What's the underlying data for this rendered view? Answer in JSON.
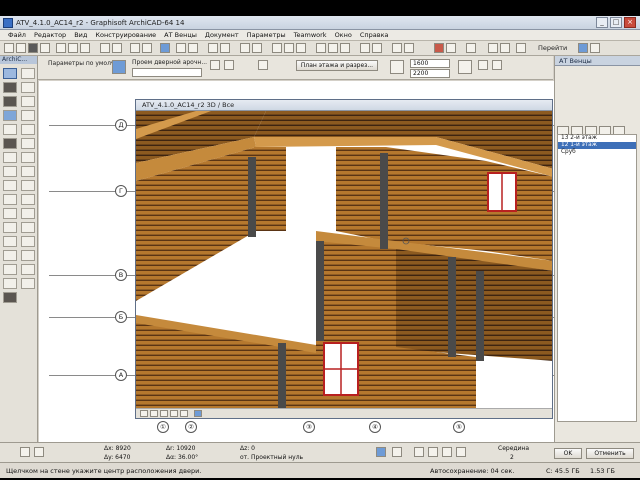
{
  "window": {
    "title": "ATV_4.1.0_AC14_r2 - Graphisoft ArchiCAD-64 14",
    "buttons": {
      "minimize": "_",
      "maximize": "□",
      "close": "×"
    }
  },
  "menu": [
    "Файл",
    "Редактор",
    "Вид",
    "Конструирование",
    "АТ Венцы",
    "Документ",
    "Параметры",
    "Teamwork",
    "Окно",
    "Справка"
  ],
  "toolbar": {
    "nav_label": "Перейти"
  },
  "toolbox": {
    "title": "ArchiC..."
  },
  "infobox": {
    "defaults_label": "Параметры по умолч.",
    "door_proj_label": "Проем дверной арочн...",
    "floor_plan_button": "План этажа и разрез...",
    "width_value": "1600",
    "height_value": "2200"
  },
  "window3d": {
    "title": "ATV_4.1.0_AC14_r2 3D / Все"
  },
  "axes": {
    "vertical": [
      "Д",
      "Г",
      "В",
      "Б",
      "А"
    ],
    "horizontal": [
      "①",
      "②",
      "③",
      "④",
      "⑤"
    ]
  },
  "navigator": {
    "title": "АТ Венцы",
    "items": [
      {
        "label": "13 2-й этаж",
        "selected": false
      },
      {
        "label": "12 1-й этаж",
        "selected": true
      },
      {
        "label": "Сруб",
        "selected": false
      }
    ]
  },
  "coords": {
    "ax": "Δx: 8920",
    "ay": "Δy: 6470",
    "ar": "Δr: 10920",
    "aa": "Δα: 36.00°",
    "az": "Δz: 0",
    "proj": "от. Проектный нуль",
    "snap": "Середина",
    "snap_value": "2",
    "ok": "OK",
    "cancel": "Отменить"
  },
  "status": {
    "hint": "Щелчком на стене укажите центр расположения двери.",
    "autosave": "Автосохранение: 04 сек.",
    "disk1": "C: 45.5 ГБ",
    "disk2": "1.53 ГБ"
  },
  "colors": {
    "wood": "#b5782e",
    "wood_dark": "#5a3414",
    "post": "#4a4a4a",
    "frame": "#b82020",
    "selection": "#3d6fb8"
  }
}
